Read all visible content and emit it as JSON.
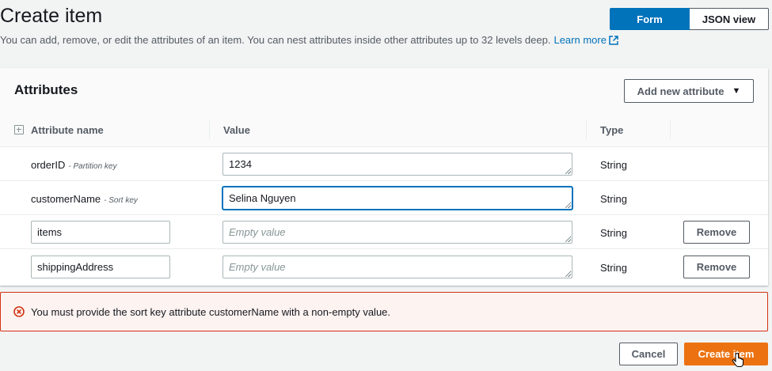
{
  "header": {
    "title": "Create item",
    "description": "You can add, remove, or edit the attributes of an item. You can nest attributes inside other attributes up to 32 levels deep.",
    "learn_more": "Learn more"
  },
  "view_toggle": {
    "form": "Form",
    "json": "JSON view",
    "selected": "Form"
  },
  "attributes": {
    "title": "Attributes",
    "add_button": "Add new attribute",
    "columns": {
      "name": "Attribute name",
      "value": "Value",
      "type": "Type"
    },
    "rows": [
      {
        "name": "orderID",
        "key_hint": "- Partition key",
        "value": "1234",
        "placeholder": "",
        "type": "String",
        "editable_name": false,
        "removable": false
      },
      {
        "name": "customerName",
        "key_hint": "- Sort key",
        "value": "Selina Nguyen",
        "placeholder": "",
        "type": "String",
        "editable_name": false,
        "removable": false
      },
      {
        "name": "items",
        "key_hint": "",
        "value": "",
        "placeholder": "Empty value",
        "type": "String",
        "editable_name": true,
        "removable": true,
        "remove_label": "Remove"
      },
      {
        "name": "shippingAddress",
        "key_hint": "",
        "value": "",
        "placeholder": "Empty value",
        "type": "String",
        "editable_name": true,
        "removable": true,
        "remove_label": "Remove"
      }
    ]
  },
  "error": {
    "message": "You must provide the sort key attribute customerName with a non-empty value."
  },
  "footer": {
    "cancel": "Cancel",
    "create": "Create item"
  },
  "colors": {
    "primary": "#0073bb",
    "accent": "#ec7211",
    "error": "#d13212"
  },
  "icons": [
    "external-link-icon",
    "caret-down-icon",
    "expand-icon",
    "resize-grip-icon",
    "error-icon",
    "cursor-icon"
  ]
}
